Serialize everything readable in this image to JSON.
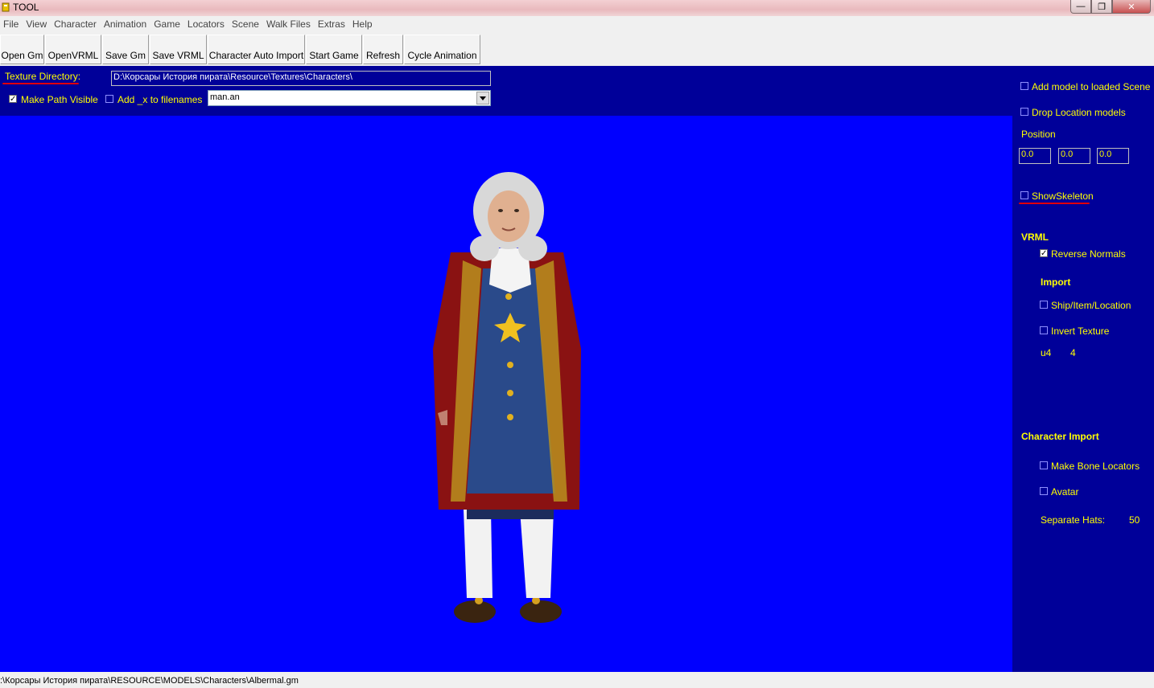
{
  "window": {
    "title": "TOOL",
    "min_glyph": "—",
    "max_glyph": "❐",
    "close_glyph": "✕"
  },
  "menu": [
    "File",
    "View",
    "Character",
    "Animation",
    "Game",
    "Locators",
    "Scene",
    "Walk Files",
    "Extras",
    "Help"
  ],
  "toolbar": [
    "Open Gm",
    "OpenVRML",
    "Save Gm",
    "Save VRML",
    "Character Auto Import",
    "Start Game",
    "Refresh",
    "Cycle Animation"
  ],
  "top_panel": {
    "texture_dir_label": "Texture Directory:",
    "texture_dir_value": "D:\\Корсары История пирата\\Resource\\Textures\\Characters\\",
    "make_path_visible": {
      "label": "Make Path Visible",
      "checked": true
    },
    "add_x": {
      "label": "Add _x to filenames",
      "checked": false
    },
    "animation_select": "man.an"
  },
  "right_panel": {
    "add_model": {
      "label": "Add model to loaded Scene",
      "checked": false
    },
    "drop_location": {
      "label": "Drop Location models",
      "checked": false
    },
    "position_label": "Position",
    "position": [
      "0.0",
      "0.0",
      "0.0"
    ],
    "show_skeleton": {
      "label": "ShowSkeleton",
      "checked": false
    },
    "vrml_heading": "VRML",
    "reverse_normals": {
      "label": "Reverse Normals",
      "checked": true
    },
    "import_heading": "Import",
    "ship_item_location": {
      "label": "Ship/Item/Location",
      "checked": false
    },
    "invert_texture": {
      "label": "Invert Texture",
      "checked": false
    },
    "u4_label": "u4",
    "u4_value": "4",
    "char_import_heading": "Character Import",
    "make_bone_locators": {
      "label": "Make Bone Locators",
      "checked": false
    },
    "avatar": {
      "label": "Avatar",
      "checked": false
    },
    "separate_hats_label": "Separate Hats:",
    "separate_hats_value": "50"
  },
  "status": ":\\Корсары История пирата\\RESOURCE\\MODELS\\Characters\\Albermal.gm",
  "colors": {
    "panel": "#000099",
    "viewport": "#0000ff",
    "accent_label": "#ffff00"
  }
}
